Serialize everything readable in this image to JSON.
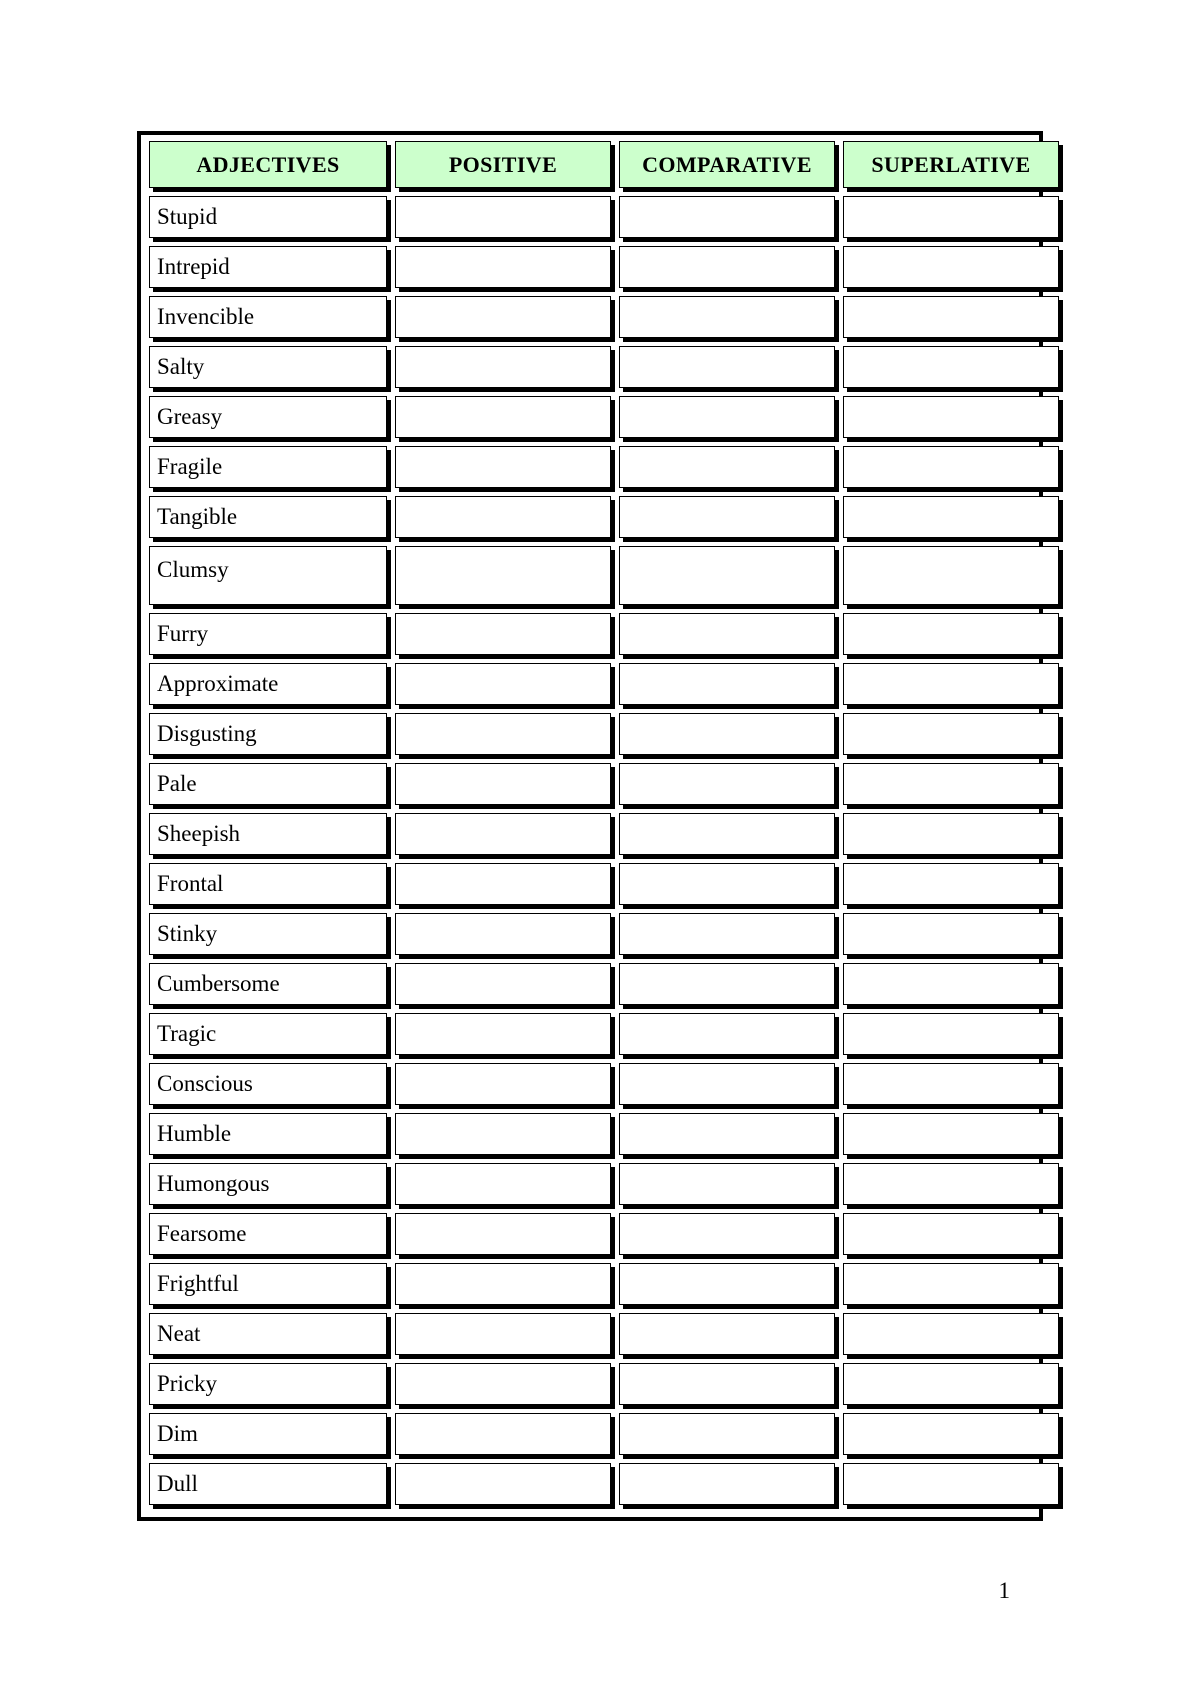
{
  "document": {
    "page_number": "1",
    "header_fill_color": "#ccffcc",
    "text_color": "#000000"
  },
  "table": {
    "columns": [
      {
        "key": "adjective",
        "label": "ADJECTIVES"
      },
      {
        "key": "positive",
        "label": "POSITIVE"
      },
      {
        "key": "comparative",
        "label": "COMPARATIVE"
      },
      {
        "key": "superlative",
        "label": "SUPERLATIVE"
      }
    ],
    "rows": [
      {
        "adjective": "Stupid",
        "positive": "",
        "comparative": "",
        "superlative": ""
      },
      {
        "adjective": "Intrepid",
        "positive": "",
        "comparative": "",
        "superlative": ""
      },
      {
        "adjective": "Invencible",
        "positive": "",
        "comparative": "",
        "superlative": ""
      },
      {
        "adjective": "Salty",
        "positive": "",
        "comparative": "",
        "superlative": ""
      },
      {
        "adjective": "Greasy",
        "positive": "",
        "comparative": "",
        "superlative": ""
      },
      {
        "adjective": "Fragile",
        "positive": "",
        "comparative": "",
        "superlative": ""
      },
      {
        "adjective": "Tangible",
        "positive": "",
        "comparative": "",
        "superlative": ""
      },
      {
        "adjective": "Clumsy",
        "positive": "",
        "comparative": "",
        "superlative": ""
      },
      {
        "adjective": "Furry",
        "positive": "",
        "comparative": "",
        "superlative": ""
      },
      {
        "adjective": "Approximate",
        "positive": "",
        "comparative": "",
        "superlative": ""
      },
      {
        "adjective": "Disgusting",
        "positive": "",
        "comparative": "",
        "superlative": ""
      },
      {
        "adjective": "Pale",
        "positive": "",
        "comparative": "",
        "superlative": ""
      },
      {
        "adjective": "Sheepish",
        "positive": "",
        "comparative": "",
        "superlative": ""
      },
      {
        "adjective": "Frontal",
        "positive": "",
        "comparative": "",
        "superlative": ""
      },
      {
        "adjective": "Stinky",
        "positive": "",
        "comparative": "",
        "superlative": ""
      },
      {
        "adjective": "Cumbersome",
        "positive": "",
        "comparative": "",
        "superlative": ""
      },
      {
        "adjective": "Tragic",
        "positive": "",
        "comparative": "",
        "superlative": ""
      },
      {
        "adjective": "Conscious",
        "positive": "",
        "comparative": "",
        "superlative": ""
      },
      {
        "adjective": "Humble",
        "positive": "",
        "comparative": "",
        "superlative": ""
      },
      {
        "adjective": "Humongous",
        "positive": "",
        "comparative": "",
        "superlative": ""
      },
      {
        "adjective": "Fearsome",
        "positive": "",
        "comparative": "",
        "superlative": ""
      },
      {
        "adjective": "Frightful",
        "positive": "",
        "comparative": "",
        "superlative": ""
      },
      {
        "adjective": "Neat",
        "positive": "",
        "comparative": "",
        "superlative": ""
      },
      {
        "adjective": "Pricky",
        "positive": "",
        "comparative": "",
        "superlative": ""
      },
      {
        "adjective": "Dim",
        "positive": "",
        "comparative": "",
        "superlative": ""
      },
      {
        "adjective": "Dull",
        "positive": "",
        "comparative": "",
        "superlative": ""
      }
    ],
    "tall_row_index": 7
  }
}
